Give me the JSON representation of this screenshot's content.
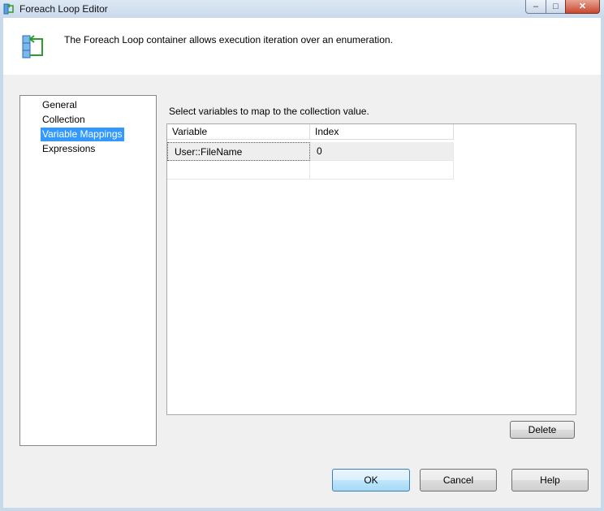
{
  "window": {
    "title": "Foreach Loop Editor",
    "minimize_glyph": "‒",
    "maximize_glyph": "□",
    "close_glyph": "✕"
  },
  "header": {
    "description": "The Foreach Loop container allows execution iteration over an enumeration.",
    "icon": "foreach-loop-icon"
  },
  "nav": {
    "items": [
      {
        "label": "General",
        "selected": false
      },
      {
        "label": "Collection",
        "selected": false
      },
      {
        "label": "Variable Mappings",
        "selected": true
      },
      {
        "label": "Expressions",
        "selected": false
      }
    ]
  },
  "main": {
    "prompt": "Select variables to map to the collection value.",
    "grid": {
      "columns": [
        "Variable",
        "Index"
      ],
      "rows": [
        {
          "variable": "User::FileName",
          "index": "0"
        },
        {
          "variable": "",
          "index": ""
        }
      ]
    },
    "delete_label": "Delete"
  },
  "footer": {
    "ok_label": "OK",
    "cancel_label": "Cancel",
    "help_label": "Help"
  },
  "colors": {
    "selection": "#3399ff",
    "client_background": "#f0f0f0"
  }
}
